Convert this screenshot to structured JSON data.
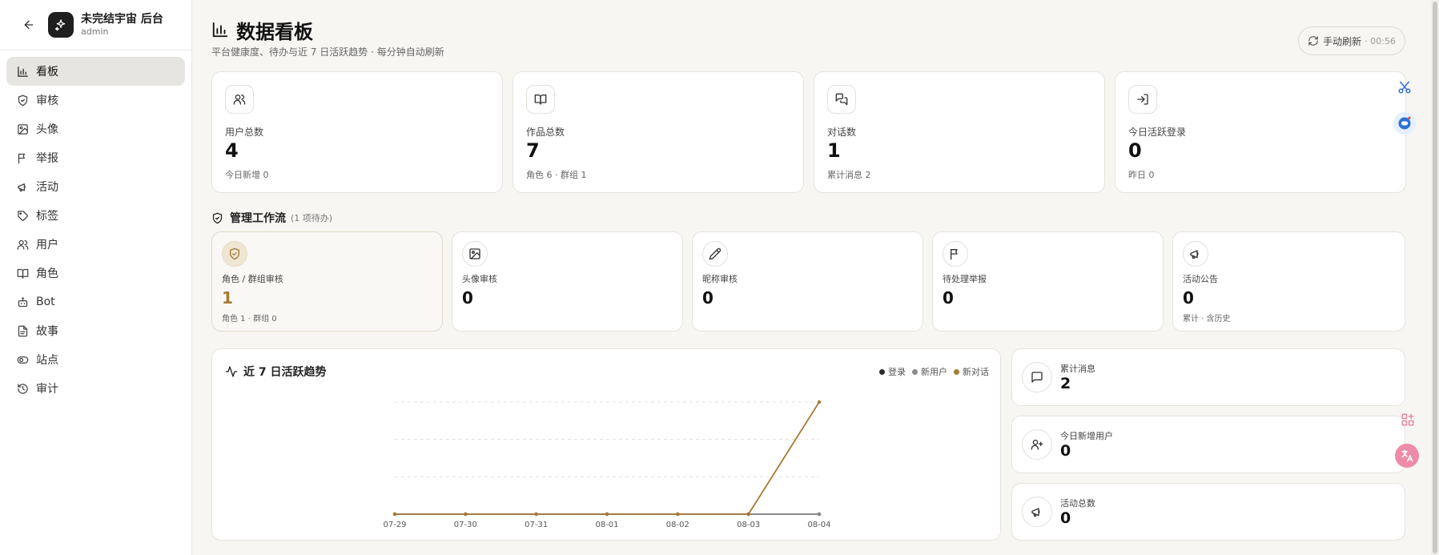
{
  "app": {
    "title": "未完结宇宙 后台",
    "user": "admin"
  },
  "nav": [
    {
      "label": "看板",
      "icon": "bar-chart-icon",
      "active": true
    },
    {
      "label": "审核",
      "icon": "shield-check-icon"
    },
    {
      "label": "头像",
      "icon": "image-icon"
    },
    {
      "label": "举报",
      "icon": "flag-icon"
    },
    {
      "label": "活动",
      "icon": "megaphone-icon"
    },
    {
      "label": "标签",
      "icon": "tag-icon"
    },
    {
      "label": "用户",
      "icon": "users-icon"
    },
    {
      "label": "角色",
      "icon": "book-open-icon"
    },
    {
      "label": "Bot",
      "icon": "bot-icon"
    },
    {
      "label": "故事",
      "icon": "file-text-icon"
    },
    {
      "label": "站点",
      "icon": "eye-toggle-icon"
    },
    {
      "label": "审计",
      "icon": "history-icon"
    }
  ],
  "header": {
    "title": "数据看板",
    "subtitle": "平台健康度、待办与近 7 日活跃趋势 · 每分钟自动刷新",
    "refresh_label": "手动刷新",
    "refresh_time": "· 00:56"
  },
  "stats": [
    {
      "label": "用户总数",
      "value": "4",
      "note": "今日新增 0",
      "icon": "users-icon"
    },
    {
      "label": "作品总数",
      "value": "7",
      "note": "角色 6 · 群组 1",
      "icon": "book-open-icon"
    },
    {
      "label": "对话数",
      "value": "1",
      "note": "累计消息 2",
      "icon": "chat-bubbles-icon"
    },
    {
      "label": "今日活跃登录",
      "value": "0",
      "note": "昨日 0",
      "icon": "login-icon"
    }
  ],
  "workflow": {
    "title": "管理工作流",
    "count": "(1 项待办)",
    "items": [
      {
        "label": "角色 / 群组审核",
        "value": "1",
        "note": "角色 1 · 群组 0",
        "icon": "shield-check-icon"
      },
      {
        "label": "头像审核",
        "value": "0",
        "note": "",
        "icon": "image-icon"
      },
      {
        "label": "昵称审核",
        "value": "0",
        "note": "",
        "icon": "pencil-icon"
      },
      {
        "label": "待处理举报",
        "value": "0",
        "note": "",
        "icon": "flag-icon"
      },
      {
        "label": "活动公告",
        "value": "0",
        "note": "累计 · 含历史",
        "icon": "megaphone-icon"
      }
    ]
  },
  "trend": {
    "title": "近 7 日活跃趋势"
  },
  "chart_data": {
    "type": "line",
    "title": "近 7 日活跃趋势",
    "x": [
      "07-29",
      "07-30",
      "07-31",
      "08-01",
      "08-02",
      "08-03",
      "08-04"
    ],
    "series": [
      {
        "name": "登录",
        "color": "#2b2b2b",
        "values": [
          0,
          0,
          0,
          0,
          0,
          0,
          0
        ]
      },
      {
        "name": "新用户",
        "color": "#8a8a8a",
        "values": [
          0,
          0,
          0,
          0,
          0,
          0,
          0
        ]
      },
      {
        "name": "新对话",
        "color": "#a57a35",
        "values": [
          0,
          0,
          0,
          0,
          0,
          0,
          1
        ]
      }
    ],
    "ylim": [
      0,
      1
    ],
    "grid": true,
    "legend": "top-right"
  },
  "mini": [
    {
      "label": "累计消息",
      "value": "2",
      "icon": "chat-icon"
    },
    {
      "label": "今日新增用户",
      "value": "0",
      "icon": "user-plus-icon"
    },
    {
      "label": "活动总数",
      "value": "0",
      "icon": "megaphone-icon"
    }
  ],
  "colors": {
    "accent": "#a57a35",
    "dark": "#1f1f1f",
    "background": "#f7f6f3"
  }
}
